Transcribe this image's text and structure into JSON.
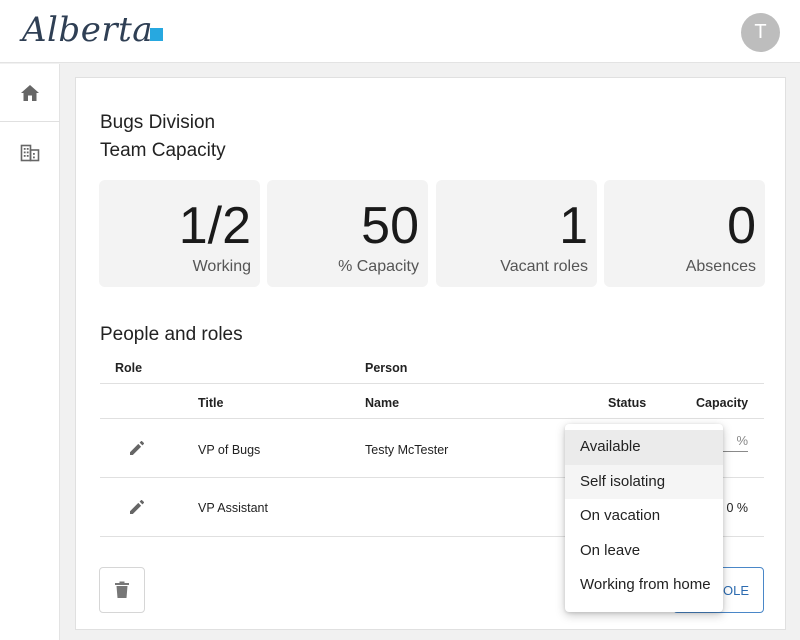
{
  "header": {
    "logo_text": "Alberta",
    "avatar_initial": "T"
  },
  "sidebar": {
    "items": [
      {
        "icon": "home-icon"
      },
      {
        "icon": "building-icon"
      }
    ]
  },
  "page": {
    "division": "Bugs Division",
    "heading": "Team Capacity"
  },
  "stats": [
    {
      "value": "1/2",
      "label": "Working"
    },
    {
      "value": "50",
      "label": "% Capacity"
    },
    {
      "value": "1",
      "label": "Vacant roles"
    },
    {
      "value": "0",
      "label": "Absences"
    }
  ],
  "people": {
    "heading": "People and roles",
    "group_headers": {
      "role": "Role",
      "person": "Person"
    },
    "columns": {
      "title": "Title",
      "name": "Name",
      "status": "Status",
      "capacity": "Capacity"
    },
    "rows": [
      {
        "title": "VP of Bugs",
        "name": "Testy McTester",
        "capacity": "%"
      },
      {
        "title": "VP Assistant",
        "name": "",
        "capacity": "0 %"
      }
    ]
  },
  "actions": {
    "add_role_label": "ROLE"
  },
  "status_menu": {
    "options": [
      "Available",
      "Self isolating",
      "On vacation",
      "On leave",
      "Working from home"
    ],
    "selected": "Available",
    "hovered": "Self isolating"
  },
  "colors": {
    "accent": "#2c6bb0",
    "logo_mark": "#27a8e0",
    "icon_gray": "#666666"
  }
}
